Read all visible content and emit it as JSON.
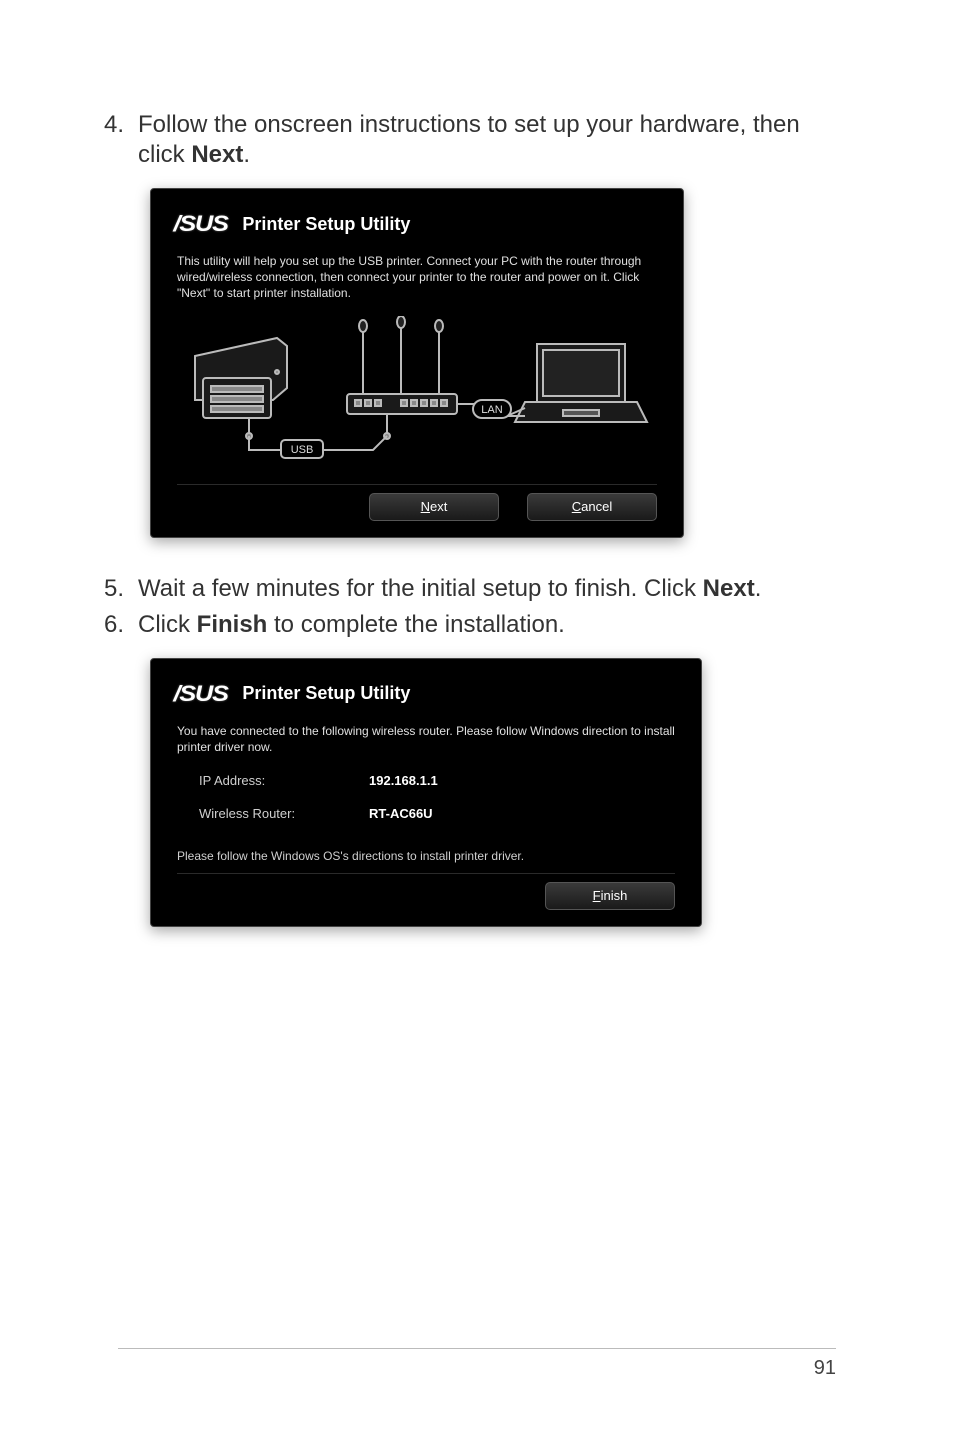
{
  "steps": {
    "s4": {
      "num": "4.",
      "text_a": "Follow the onscreen instructions to set up your hardware, then click ",
      "bold": "Next",
      "text_b": "."
    },
    "s5": {
      "num": "5.",
      "text_a": "Wait a few minutes for the initial setup to finish. Click ",
      "bold": "Next",
      "text_b": "."
    },
    "s6": {
      "num": "6.",
      "text_a": "Click ",
      "bold": "Finish",
      "text_b": " to complete the installation."
    }
  },
  "dialog1": {
    "title": "Printer Setup Utility",
    "desc": "This utility will help you set up the USB printer. Connect your PC with the router through wired/wireless connection, then connect your printer to the router and power on it. Click \"Next\" to start printer installation.",
    "usb_label": "USB",
    "lan_label": "LAN",
    "next_prefix": "N",
    "next_rest": "ext",
    "cancel_prefix": "C",
    "cancel_rest": "ancel"
  },
  "dialog2": {
    "title": "Printer Setup Utility",
    "desc": "You have connected to the following wireless router. Please follow Windows direction to install printer driver now.",
    "ip_label": "IP Address:",
    "ip_value": "192.168.1.1",
    "router_label": "Wireless Router:",
    "router_value": "RT-AC66U",
    "note": "Please follow the Windows OS's directions to install printer driver.",
    "finish_prefix": "F",
    "finish_rest": "inish"
  },
  "page_number": "91"
}
